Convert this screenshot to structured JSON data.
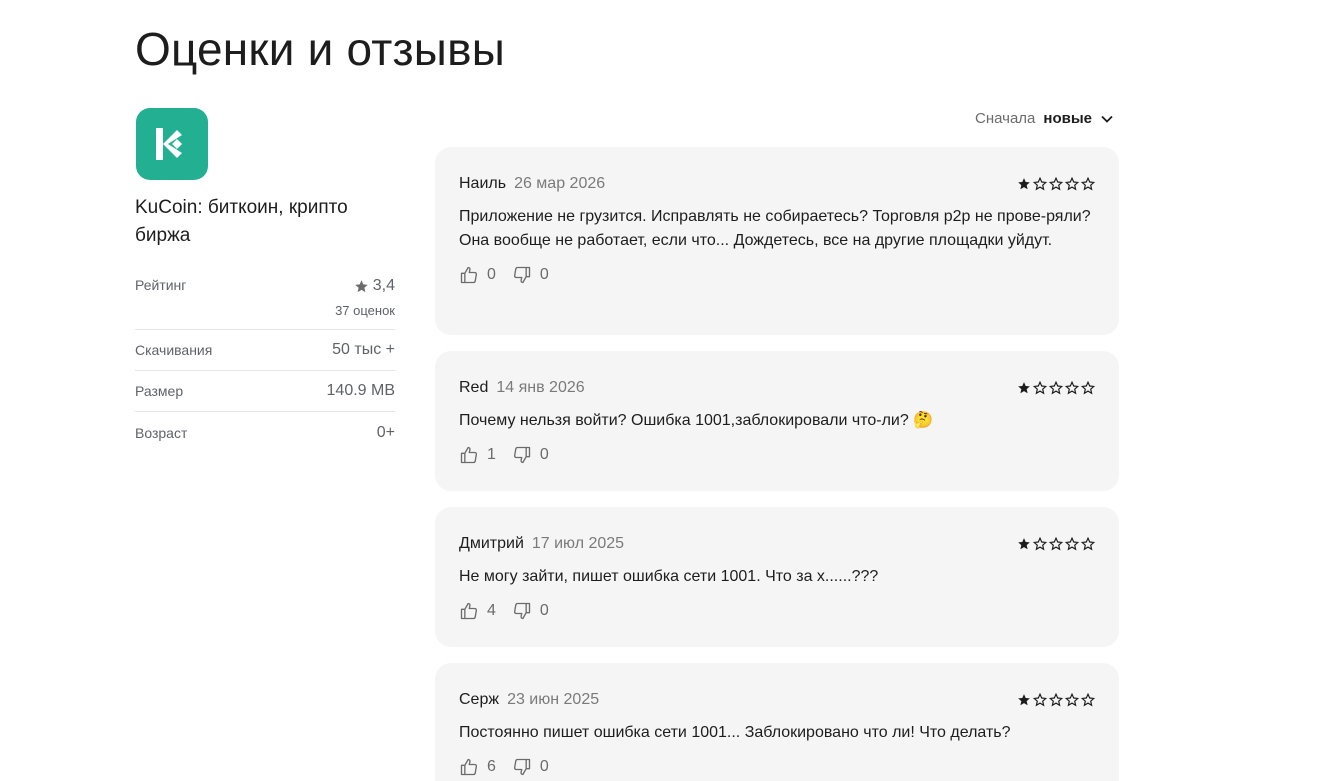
{
  "page": {
    "title": "Оценки и отзывы"
  },
  "app": {
    "name": "KuCoin: биткоин, крипто биржа",
    "icon": "kucoin-logo-icon",
    "icon_color": "#23af91",
    "info": {
      "rating_label": "Рейтинг",
      "rating_value": "3,4",
      "rating_count": "37 оценок",
      "downloads_label": "Скачивания",
      "downloads_value": "50 тыс +",
      "size_label": "Размер",
      "size_value": "140.9 MB",
      "age_label": "Возраст",
      "age_value": "0+"
    }
  },
  "sort": {
    "label": "Сначала",
    "value": "новые",
    "icon": "chevron-down-icon"
  },
  "reviews": [
    {
      "author": "Наиль",
      "date": "26 мар 2026",
      "stars": 1,
      "text": "Приложение не грузится. Исправлять не собираетесь? Торговля p2p не прове-ряли? Она вообще не работает, если что... Дождетесь, все на другие площадки уйдут.",
      "likes": "0",
      "dislikes": "0"
    },
    {
      "author": "Red",
      "date": "14 янв 2026",
      "stars": 1,
      "text": "Почему нельзя войти? Ошибка 1001,заблокировали что-ли? 🤔",
      "likes": "1",
      "dislikes": "0"
    },
    {
      "author": "Дмитрий",
      "date": "17 июл 2025",
      "stars": 1,
      "text": "Не могу зайти, пишет ошибка сети 1001. Что за х......???",
      "likes": "4",
      "dislikes": "0"
    },
    {
      "author": "Серж",
      "date": "23 июн 2025",
      "stars": 1,
      "text": "Постоянно пишет ошибка сети 1001... Заблокировано что ли! Что делать?",
      "likes": "6",
      "dislikes": "0"
    }
  ]
}
